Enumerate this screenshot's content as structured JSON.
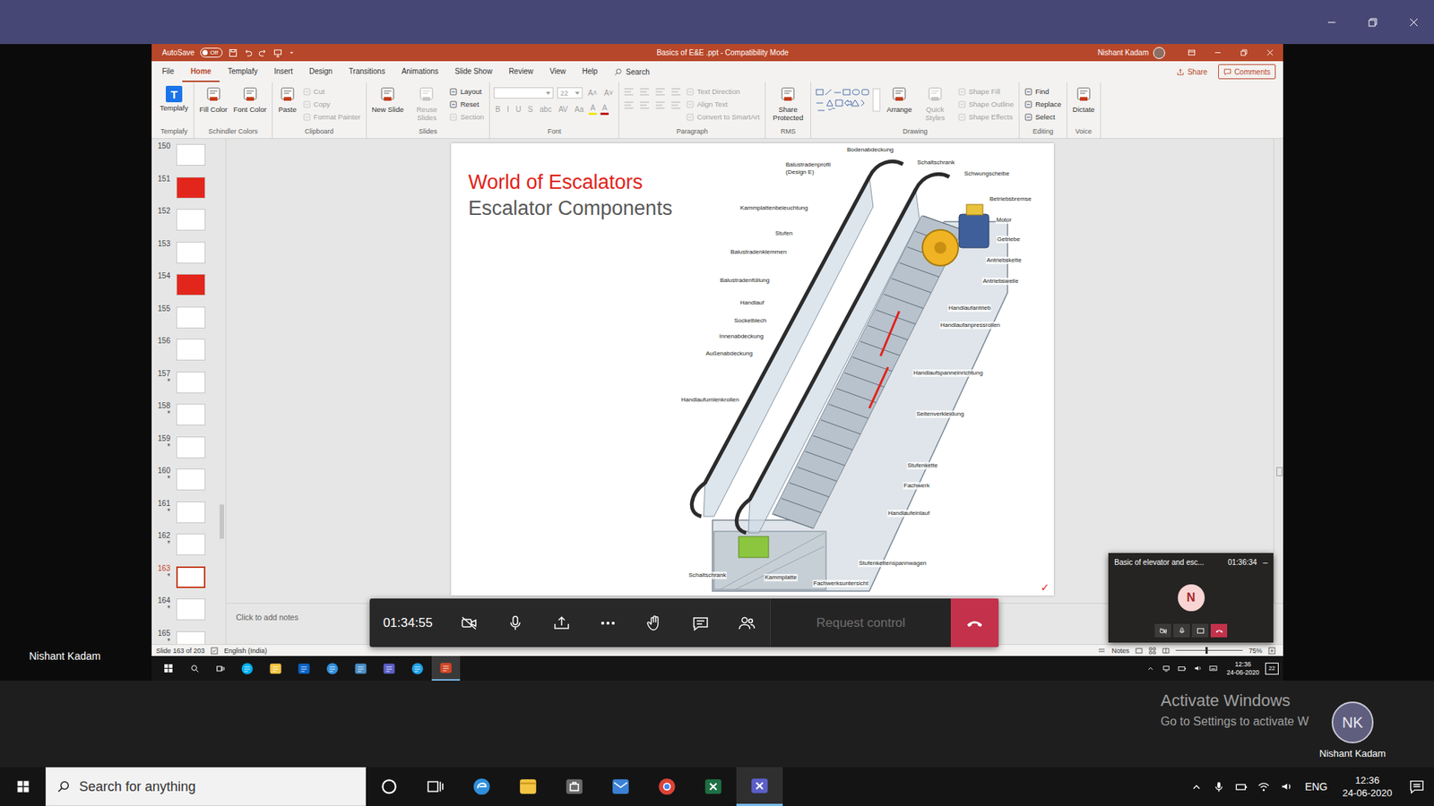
{
  "presenter_label": "Nishant Kadam",
  "ppt": {
    "title_bar": {
      "autosave_label": "AutoSave",
      "autosave_state": "Off",
      "autosave_on": false,
      "title": "Basics of E&E .ppt - Compatibility Mode",
      "user": "Nishant Kadam"
    },
    "tabs": [
      {
        "label": "File",
        "selected": false
      },
      {
        "label": "Home",
        "selected": true
      },
      {
        "label": "Templafy",
        "selected": false
      },
      {
        "label": "Insert",
        "selected": false
      },
      {
        "label": "Design",
        "selected": false
      },
      {
        "label": "Transitions",
        "selected": false
      },
      {
        "label": "Animations",
        "selected": false
      },
      {
        "label": "Slide Show",
        "selected": false
      },
      {
        "label": "Review",
        "selected": false
      },
      {
        "label": "View",
        "selected": false
      },
      {
        "label": "Help",
        "selected": false
      }
    ],
    "search": {
      "placeholder": "Search"
    },
    "share": "Share",
    "comments": "Comments",
    "ribbon": [
      {
        "label": "Templafy",
        "columns": [
          {
            "kind": "large",
            "label": "Templafy",
            "badge": "T",
            "disabled": false
          }
        ]
      },
      {
        "label": "Schindler Colors",
        "columns": [
          {
            "kind": "large",
            "label": "Fill Color",
            "disabled": false
          },
          {
            "kind": "large",
            "label": "Font Color",
            "disabled": false
          }
        ]
      },
      {
        "label": "Clipboard",
        "columns": [
          {
            "kind": "large",
            "label": "Paste",
            "disabled": false
          },
          {
            "kind": "stack",
            "items": [
              {
                "label": "Cut",
                "disabled": true
              },
              {
                "label": "Copy",
                "disabled": true
              },
              {
                "label": "Format Painter",
                "disabled": true
              }
            ]
          }
        ]
      },
      {
        "label": "Slides",
        "columns": [
          {
            "kind": "large",
            "label": "New Slide",
            "disabled": false
          },
          {
            "kind": "large",
            "label": "Reuse Slides",
            "disabled": true
          },
          {
            "kind": "stack",
            "items": [
              {
                "label": "Layout",
                "disabled": false
              },
              {
                "label": "Reset",
                "disabled": false
              },
              {
                "label": "Section",
                "disabled": true
              }
            ]
          }
        ]
      },
      {
        "label": "Font",
        "columns": [
          {
            "kind": "rows",
            "rows": [
              [
                {
                  "kind": "fontbox",
                  "value": "",
                  "disabled": true
                },
                {
                  "kind": "sizebox",
                  "value": "22",
                  "disabled": true
                },
                {
                  "kind": "glyph",
                  "value": "A˄",
                  "disabled": true
                },
                {
                  "kind": "glyph",
                  "value": "A˅",
                  "disabled": true
                }
              ],
              [
                {
                  "kind": "glyph",
                  "value": "B",
                  "disabled": true
                },
                {
                  "kind": "glyph",
                  "value": "I",
                  "disabled": true
                },
                {
                  "kind": "glyph",
                  "value": "U",
                  "disabled": true
                },
                {
                  "kind": "glyph",
                  "value": "S",
                  "disabled": true
                },
                {
                  "kind": "glyph",
                  "value": "abc",
                  "disabled": true
                },
                {
                  "kind": "glyph",
                  "value": "AV",
                  "disabled": true
                },
                {
                  "kind": "glyph",
                  "value": "Aa",
                  "disabled": true
                },
                {
                  "kind": "glyph",
                  "value": "A",
                  "disabled": true,
                  "color": "#f2e600"
                },
                {
                  "kind": "glyph",
                  "value": "A",
                  "disabled": true,
                  "color": "#c00000"
                }
              ]
            ]
          }
        ]
      },
      {
        "label": "Paragraph",
        "columns": [
          {
            "kind": "rows",
            "rows": [
              [
                {
                  "kind": "lines",
                  "disabled": true
                },
                {
                  "kind": "lines",
                  "disabled": true
                },
                {
                  "kind": "lines",
                  "disabled": true
                },
                {
                  "kind": "lines",
                  "disabled": true
                }
              ],
              [
                {
                  "kind": "lines",
                  "disabled": true
                },
                {
                  "kind": "lines",
                  "disabled": true
                },
                {
                  "kind": "lines",
                  "disabled": true
                },
                {
                  "kind": "lines",
                  "disabled": true
                }
              ]
            ]
          },
          {
            "kind": "stack",
            "items": [
              {
                "label": "Text Direction",
                "disabled": true
              },
              {
                "label": "Align Text",
                "disabled": true
              },
              {
                "label": "Convert to SmartArt",
                "disabled": true
              }
            ]
          }
        ]
      },
      {
        "label": "RMS",
        "columns": [
          {
            "kind": "large",
            "label": "Share Protected",
            "disabled": false
          }
        ]
      },
      {
        "label": "Drawing",
        "columns": [
          {
            "kind": "gallery"
          },
          {
            "kind": "large",
            "label": "Arrange",
            "disabled": false
          },
          {
            "kind": "large",
            "label": "Quick Styles",
            "disabled": true
          },
          {
            "kind": "stack",
            "items": [
              {
                "label": "Shape Fill",
                "disabled": true
              },
              {
                "label": "Shape Outline",
                "disabled": true
              },
              {
                "label": "Shape Effects",
                "disabled": true
              }
            ]
          }
        ]
      },
      {
        "label": "Editing",
        "columns": [
          {
            "kind": "stack",
            "items": [
              {
                "label": "Find",
                "disabled": false
              },
              {
                "label": "Replace",
                "disabled": false
              },
              {
                "label": "Select",
                "disabled": false
              }
            ]
          }
        ]
      },
      {
        "label": "Voice",
        "columns": [
          {
            "kind": "large",
            "label": "Dictate",
            "disabled": false
          }
        ]
      }
    ],
    "star_glyph": "*",
    "thumbnails": [
      {
        "number": "150",
        "animated": false,
        "selected": false,
        "color": "#ffffff"
      },
      {
        "number": "151",
        "animated": false,
        "selected": false,
        "color": "#e3261c"
      },
      {
        "number": "152",
        "animated": false,
        "selected": false,
        "color": "#ffffff"
      },
      {
        "number": "153",
        "animated": false,
        "selected": false,
        "color": "#ffffff"
      },
      {
        "number": "154",
        "animated": false,
        "selected": false,
        "color": "#e3261c"
      },
      {
        "number": "155",
        "animated": false,
        "selected": false,
        "color": "#ffffff"
      },
      {
        "number": "156",
        "animated": false,
        "selected": false,
        "color": "#ffffff"
      },
      {
        "number": "157",
        "animated": true,
        "selected": false,
        "color": "#ffffff"
      },
      {
        "number": "158",
        "animated": true,
        "selected": false,
        "color": "#ffffff"
      },
      {
        "number": "159",
        "animated": true,
        "selected": false,
        "color": "#ffffff"
      },
      {
        "number": "160",
        "animated": true,
        "selected": false,
        "color": "#ffffff"
      },
      {
        "number": "161",
        "animated": true,
        "selected": false,
        "color": "#ffffff"
      },
      {
        "number": "162",
        "animated": true,
        "selected": false,
        "color": "#ffffff"
      },
      {
        "number": "163",
        "animated": true,
        "selected": true,
        "color": "#ffffff"
      },
      {
        "number": "164",
        "animated": true,
        "selected": false,
        "color": "#ffffff"
      },
      {
        "number": "165",
        "animated": true,
        "selected": false,
        "color": "#ffffff"
      }
    ],
    "slide": {
      "title": "World of Escalators",
      "subtitle": "Escalator Components",
      "labels": [
        "Bodenabdeckung",
        "Schaltschrank",
        "Balustradenprofil (Design E)",
        "Schwungscheibe",
        "Betriebsbremse",
        "Kammplattenbeleuchtung",
        "Motor",
        "Stufen",
        "Getriebe",
        "Balustradenklemmen",
        "Antriebskette",
        "Balustradenfüllung",
        "Antriebswelle",
        "Handlauf",
        "Handlaufantrieb",
        "Sockelblech",
        "Handlaufanpressrollen",
        "Innenabdeckung",
        "Außenabdeckung",
        "Handlaufspanneinrichtung",
        "Handlaufumlenkrollen",
        "Seitenverkleidung",
        "Stufenkette",
        "Fachwerk",
        "Handlaufeinlauf",
        "Stufenkettenspannwagen",
        "Schaltschrank",
        "Kammplatte",
        "Fachwerksuntersicht"
      ],
      "mark": "✓"
    },
    "notes_placeholder": "Click to add notes",
    "status": {
      "slide": "Slide 163 of 203",
      "language": "English (India)",
      "notes": "Notes",
      "zoom": "75%"
    }
  },
  "remote_taskbar": {
    "apps": [
      {
        "kind": "skype",
        "active": false
      },
      {
        "kind": "explorer",
        "active": false
      },
      {
        "kind": "outlook",
        "active": false
      },
      {
        "kind": "edge",
        "active": false
      },
      {
        "kind": "app",
        "active": false
      },
      {
        "kind": "teams",
        "active": false
      },
      {
        "kind": "ie",
        "active": false
      },
      {
        "kind": "powerpoint",
        "active": true
      }
    ],
    "time": "12:36",
    "date": "24-06-2020",
    "notifications": "22"
  },
  "call_bar": {
    "timer": "01:34:55",
    "camera_on": false,
    "request_control": "Request control",
    "request_enabled": false
  },
  "mini_window": {
    "title": "Basic of elevator and esc...",
    "time": "01:36:34",
    "minimize": "–",
    "avatar": "N"
  },
  "watermark": {
    "title": "Activate Windows",
    "subtitle": "Go to Settings to activate W"
  },
  "self_view": {
    "initials": "NK",
    "name": "Nishant Kadam"
  },
  "taskbar": {
    "search_placeholder": "Search for anything",
    "apps": [
      {
        "kind": "edge",
        "active": false
      },
      {
        "kind": "explorer",
        "active": false
      },
      {
        "kind": "store",
        "active": false
      },
      {
        "kind": "mail",
        "active": false
      },
      {
        "kind": "chrome",
        "active": false
      },
      {
        "kind": "excel",
        "active": false
      },
      {
        "kind": "teams",
        "active": true
      }
    ],
    "language": "ENG",
    "time": "12:36",
    "date": "24-06-2020"
  }
}
